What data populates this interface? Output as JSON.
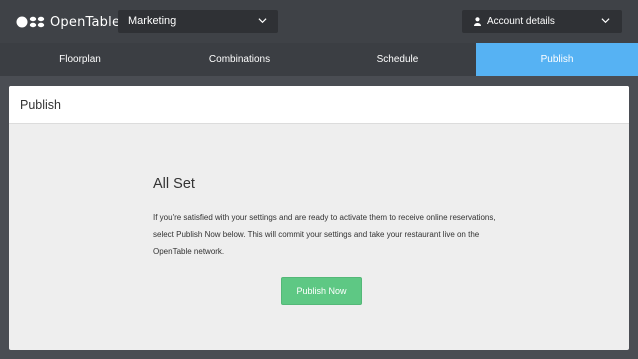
{
  "header": {
    "logo_text": "OpenTable",
    "logo_mark": "·",
    "restaurant_select": "Marketing",
    "account_label": "Account details"
  },
  "tabs": [
    {
      "label": "Floorplan",
      "active": false
    },
    {
      "label": "Combinations",
      "active": false
    },
    {
      "label": "Schedule",
      "active": false
    },
    {
      "label": "Publish",
      "active": true
    }
  ],
  "card": {
    "title": "Publish",
    "heading": "All Set",
    "body": "If you're satisfied with your settings and are ready to activate them to receive online reservations, select Publish Now below. This will commit your settings and take your restaurant live on the OpenTable network.",
    "button_label": "Publish Now"
  },
  "colors": {
    "accent_tab": "#56b2f3",
    "publish_button": "#5ec884",
    "header_bg": "#3f4247"
  },
  "icons": [
    "opentable-logo-icon",
    "chevron-down-icon",
    "person-icon"
  ]
}
